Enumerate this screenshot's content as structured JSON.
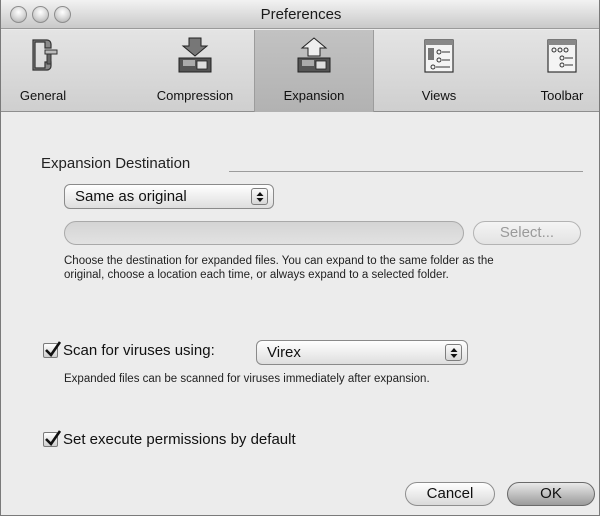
{
  "window": {
    "title": "Preferences"
  },
  "toolbar": {
    "items": [
      {
        "label": "General",
        "icon": "clamp-icon"
      },
      {
        "label": "Compression",
        "icon": "compress-icon"
      },
      {
        "label": "Expansion",
        "icon": "expand-icon"
      },
      {
        "label": "Views",
        "icon": "views-icon"
      },
      {
        "label": "Toolbar",
        "icon": "toolbar-icon"
      }
    ],
    "selected": "Expansion"
  },
  "expansion": {
    "section_title": "Expansion Destination",
    "destination_selected": "Same as original",
    "path_value": "",
    "select_button": "Select...",
    "help_line1": "Choose the destination for expanded files.  You can expand to the same folder as the",
    "help_line2": "original, choose a location each time, or always expand to a selected folder."
  },
  "virus": {
    "checkbox_label": "Scan for viruses using:",
    "checked": true,
    "scanner_selected": "Virex",
    "help": "Expanded files can be scanned for viruses immediately after expansion."
  },
  "permissions": {
    "checkbox_label": "Set execute permissions by default",
    "checked": true
  },
  "buttons": {
    "cancel": "Cancel",
    "ok": "OK"
  }
}
